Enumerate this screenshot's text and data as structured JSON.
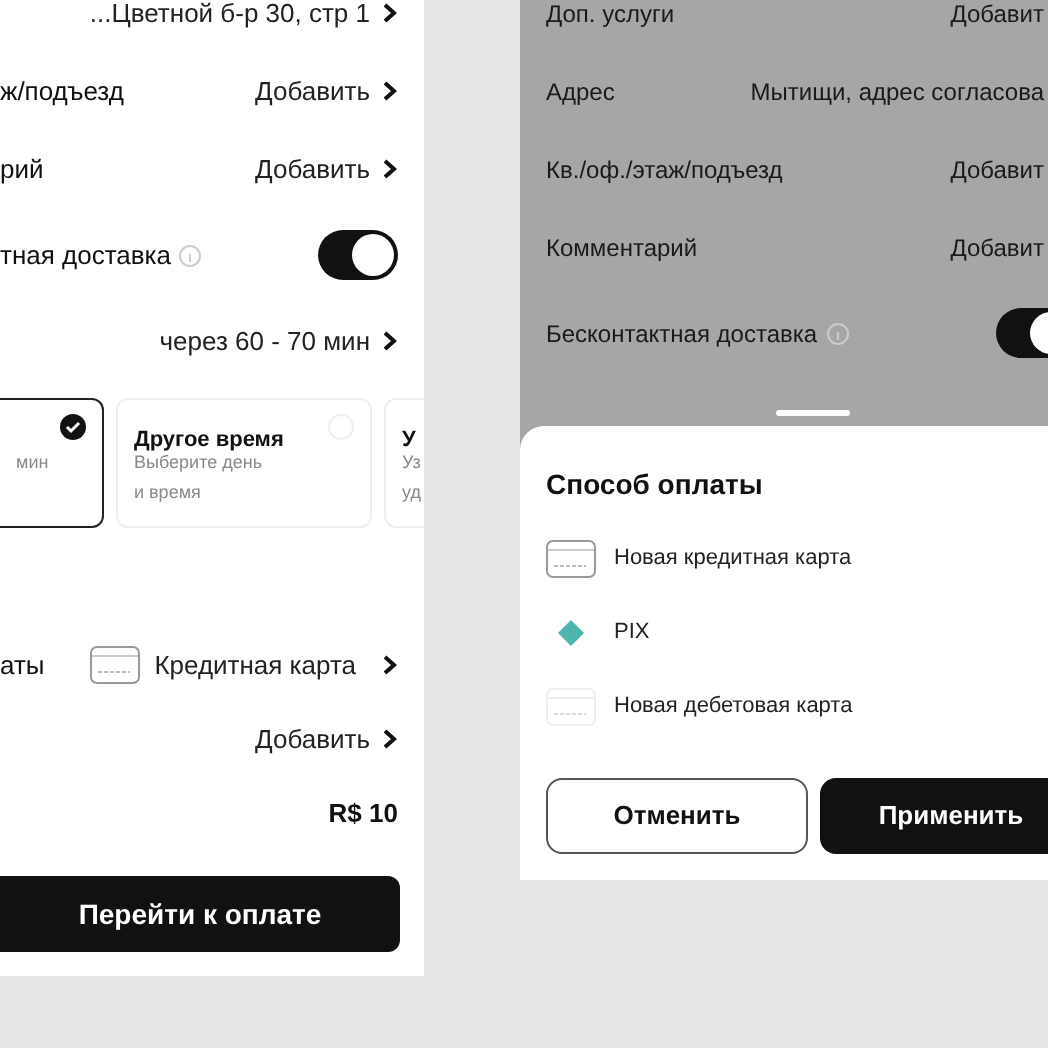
{
  "left": {
    "rows": [
      {
        "kind": "link",
        "value": "...Цветной б-р 30, стр 1"
      },
      {
        "kind": "link",
        "label": "ж/подъезд",
        "value": "Добавить"
      },
      {
        "kind": "link",
        "label": "рий",
        "value": "Добавить"
      },
      {
        "kind": "toggle",
        "label": "тная доставка",
        "on": true
      },
      {
        "kind": "link",
        "value": "через 60 - 70 мин"
      }
    ],
    "time_cards": [
      {
        "lines": [
          "мин"
        ],
        "selected": true
      },
      {
        "title": "Другое время",
        "lines": [
          "Выберите день",
          "и время"
        ],
        "selected": false
      },
      {
        "title": "У",
        "lines": [
          "Уз",
          "уд"
        ],
        "selected": false
      }
    ],
    "payment_rows": [
      {
        "kind": "card",
        "label": "аты",
        "value": "Кредитная карта"
      },
      {
        "kind": "link",
        "value": "Добавить"
      },
      {
        "kind": "total",
        "value": "R$ 10"
      }
    ],
    "checkout_button": "Перейти к оплате"
  },
  "right": {
    "rows": [
      {
        "kind": "link",
        "label": "Доп. услуги",
        "value": "Добавит"
      },
      {
        "kind": "text",
        "label": "Адрес",
        "value": "Мытищи, адрес согласова"
      },
      {
        "kind": "link",
        "label": "Кв./оф./этаж/подъезд",
        "value": "Добавит"
      },
      {
        "kind": "link",
        "label": "Комментарий",
        "value": "Добавит"
      },
      {
        "kind": "toggle",
        "label": "Бесконтактная доставка",
        "on": true
      }
    ],
    "sheet": {
      "title": "Способ оплаты",
      "options": [
        {
          "kind": "credit",
          "label": "Новая кредитная карта"
        },
        {
          "kind": "pix",
          "label": "PIX"
        },
        {
          "kind": "debit",
          "label": "Новая дебетовая карта"
        }
      ],
      "buttons": [
        {
          "kind": "secondary",
          "label": "Отменить"
        },
        {
          "kind": "primary",
          "label": "Применить"
        }
      ]
    }
  }
}
